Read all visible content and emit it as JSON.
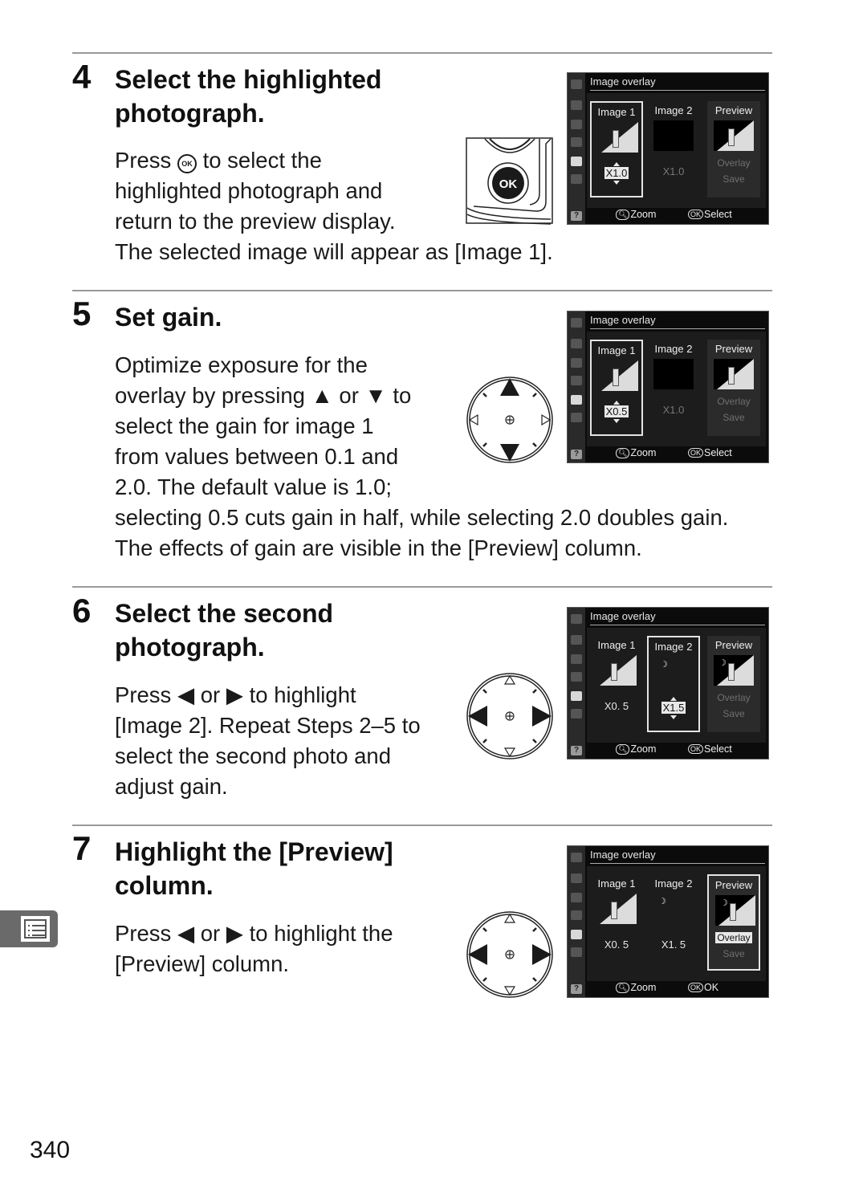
{
  "steps": [
    {
      "number": "4",
      "title_lines": [
        "Select the highlighted",
        "photograph."
      ],
      "body_lines": [
        {
          "pre": "Press ",
          "icon": "ok-button-icon",
          "post": " to select the"
        },
        {
          "text": "highlighted photograph and"
        },
        {
          "text": "return to the preview display."
        },
        {
          "text": "The selected image will appear as [Image 1]."
        }
      ],
      "illustration": "ok-button",
      "screen": {
        "title": "Image overlay",
        "columns": [
          "Image 1",
          "Image 2",
          "Preview"
        ],
        "selected_column": "Image 1",
        "image1_gain": "X1.0",
        "image2_gain": "X1.0",
        "preview_options": [
          "Overlay",
          "Save"
        ],
        "highlighted_option": "",
        "footer": {
          "zoom_label": "Zoom",
          "action_label": "Select"
        }
      }
    },
    {
      "number": "5",
      "title_lines": [
        "Set gain."
      ],
      "body_lines": [
        {
          "text": "Optimize exposure for the"
        },
        {
          "pre": "overlay by pressing ",
          "icon": "up-arrow-icon",
          "mid": " or ",
          "icon2": "down-arrow-icon",
          "post": " to"
        },
        {
          "text": "select the gain for image 1"
        },
        {
          "text": "from values between 0.1 and"
        },
        {
          "text": "2.0.  The default value is 1.0;"
        },
        {
          "text": "selecting 0.5 cuts gain in half, while selecting 2.0 doubles gain."
        },
        {
          "text": "The effects of gain are visible in the [Preview] column."
        }
      ],
      "illustration": "multi-selector-up-down",
      "screen": {
        "title": "Image overlay",
        "columns": [
          "Image 1",
          "Image 2",
          "Preview"
        ],
        "selected_column": "Image 1",
        "image1_gain": "X0.5",
        "image2_gain": "X1.0",
        "preview_options": [
          "Overlay",
          "Save"
        ],
        "highlighted_option": "",
        "footer": {
          "zoom_label": "Zoom",
          "action_label": "Select"
        }
      }
    },
    {
      "number": "6",
      "title_lines": [
        "Select the second",
        "photograph."
      ],
      "body_lines": [
        {
          "pre": "Press ",
          "icon": "left-arrow-icon",
          "mid": " or ",
          "icon2": "right-arrow-icon",
          "post": " to highlight"
        },
        {
          "text": "[Image 2].  Repeat Steps 2–5 to"
        },
        {
          "text": "select the second photo and"
        },
        {
          "text": "adjust gain."
        }
      ],
      "illustration": "multi-selector-left-right",
      "screen": {
        "title": "Image overlay",
        "columns": [
          "Image 1",
          "Image 2",
          "Preview"
        ],
        "selected_column": "Image 2",
        "image1_gain": "X0. 5",
        "image2_gain": "X1.5",
        "preview_options": [
          "Overlay",
          "Save"
        ],
        "highlighted_option": "",
        "footer": {
          "zoom_label": "Zoom",
          "action_label": "Select"
        }
      }
    },
    {
      "number": "7",
      "title_lines": [
        "Highlight the [Preview]",
        "column."
      ],
      "body_lines": [
        {
          "pre": "Press ",
          "icon": "left-arrow-icon",
          "mid": " or ",
          "icon2": "right-arrow-icon",
          "post": "  to highlight the"
        },
        {
          "text": "[Preview] column."
        }
      ],
      "illustration": "multi-selector-left-right",
      "screen": {
        "title": "Image overlay",
        "columns": [
          "Image 1",
          "Image 2",
          "Preview"
        ],
        "selected_column": "Preview",
        "image1_gain": "X0. 5",
        "image2_gain": "X1. 5",
        "preview_options": [
          "Overlay",
          "Save"
        ],
        "highlighted_option": "Overlay",
        "footer": {
          "zoom_label": "Zoom",
          "action_label": "OK"
        }
      }
    }
  ],
  "glyphs": {
    "up": "▲",
    "down": "▼",
    "left": "◀",
    "right": "▶",
    "ok": "OK",
    "help": "?",
    "moon": "☽"
  },
  "side_tab": {
    "icon": "menu-list-icon"
  },
  "page_number": "340"
}
